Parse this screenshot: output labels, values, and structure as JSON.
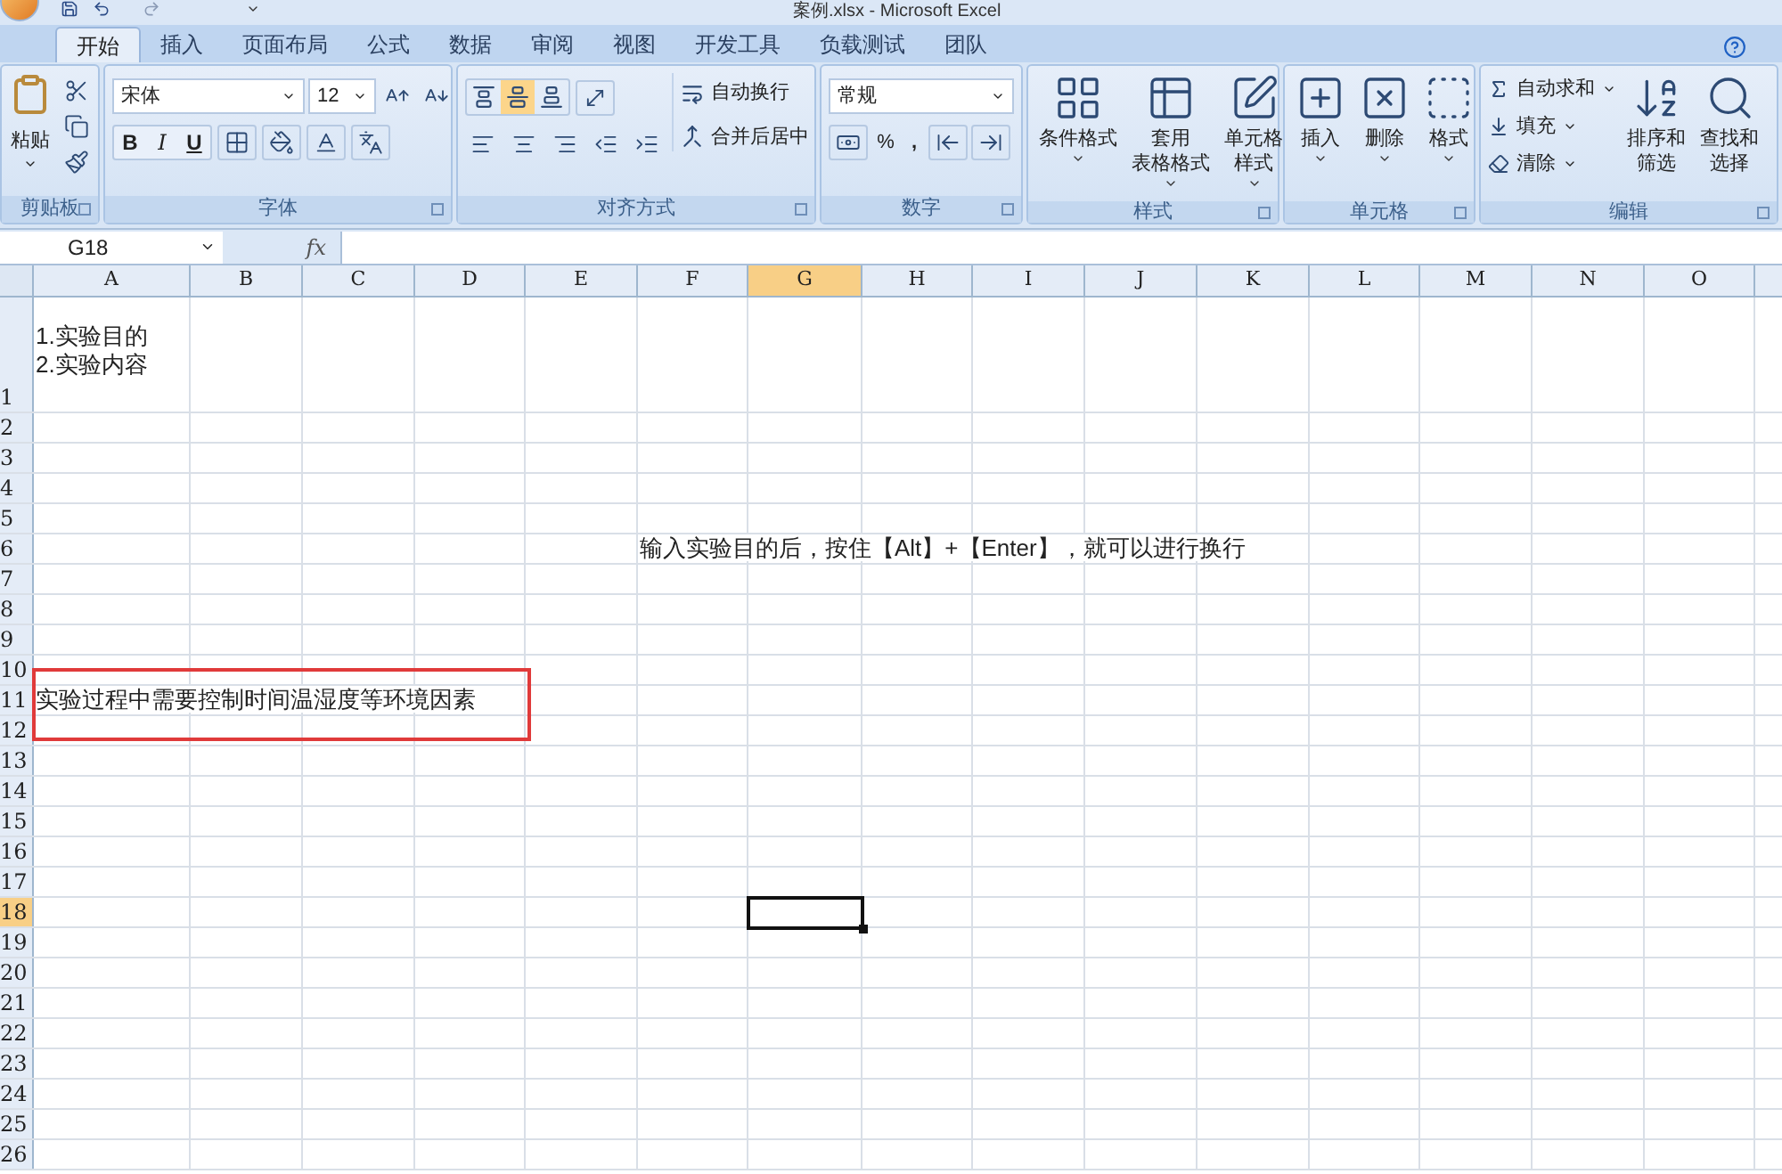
{
  "window": {
    "title": "案例.xlsx - Microsoft Excel"
  },
  "tabs": [
    {
      "label": "开始",
      "selected": true
    },
    {
      "label": "插入",
      "selected": false
    },
    {
      "label": "页面布局",
      "selected": false
    },
    {
      "label": "公式",
      "selected": false
    },
    {
      "label": "数据",
      "selected": false
    },
    {
      "label": "审阅",
      "selected": false
    },
    {
      "label": "视图",
      "selected": false
    },
    {
      "label": "开发工具",
      "selected": false
    },
    {
      "label": "负载测试",
      "selected": false
    },
    {
      "label": "团队",
      "selected": false
    }
  ],
  "ribbon": {
    "clipboard": {
      "label": "剪贴板",
      "paste": "粘贴"
    },
    "font": {
      "label": "字体",
      "font_name": "宋体",
      "font_size": "12",
      "bold": "B",
      "italic": "I",
      "underline": "U"
    },
    "alignment": {
      "label": "对齐方式",
      "vertical": [
        {
          "selected": false
        },
        {
          "selected": true
        },
        {
          "selected": false
        }
      ],
      "wrap_text": "自动换行",
      "merge_center": "合并后居中"
    },
    "number": {
      "label": "数字",
      "format": "常规",
      "percent": "%",
      "comma": ","
    },
    "styles": {
      "label": "样式",
      "buttons": [
        [
          "条件格式"
        ],
        [
          "套用",
          "表格格式"
        ],
        [
          "单元格",
          "样式"
        ]
      ]
    },
    "cells": {
      "label": "单元格",
      "buttons": [
        "插入",
        "删除",
        "格式"
      ]
    },
    "editing": {
      "label": "编辑",
      "small": [
        "自动求和",
        "填充",
        "清除"
      ],
      "large": [
        [
          "排序和",
          "筛选"
        ],
        [
          "查找和",
          "选择"
        ]
      ]
    }
  },
  "name_box": "G18",
  "formula_label": "fx",
  "columns": [
    {
      "label": "A",
      "selected": false
    },
    {
      "label": "B",
      "selected": false
    },
    {
      "label": "C",
      "selected": false
    },
    {
      "label": "D",
      "selected": false
    },
    {
      "label": "E",
      "selected": false
    },
    {
      "label": "F",
      "selected": false
    },
    {
      "label": "G",
      "selected": true
    },
    {
      "label": "H",
      "selected": false
    },
    {
      "label": "I",
      "selected": false
    },
    {
      "label": "J",
      "selected": false
    },
    {
      "label": "K",
      "selected": false
    },
    {
      "label": "L",
      "selected": false
    },
    {
      "label": "M",
      "selected": false
    },
    {
      "label": "N",
      "selected": false
    },
    {
      "label": "O",
      "selected": false
    }
  ],
  "rows": [
    {
      "label": "1",
      "selected": false,
      "cells": [
        [
          "1.实验目的",
          "2.实验内容"
        ]
      ]
    },
    {
      "label": "2",
      "selected": false
    },
    {
      "label": "3",
      "selected": false
    },
    {
      "label": "4",
      "selected": false
    },
    {
      "label": "5",
      "selected": false
    },
    {
      "label": "6",
      "selected": false,
      "cells": [
        null,
        null,
        null,
        null,
        null,
        [
          "输入实验目的后，按住【Alt】+【Enter】，就可以进行换行"
        ]
      ]
    },
    {
      "label": "7",
      "selected": false
    },
    {
      "label": "8",
      "selected": false
    },
    {
      "label": "9",
      "selected": false
    },
    {
      "label": "10",
      "selected": false
    },
    {
      "label": "11",
      "selected": false,
      "cells": [
        [
          "实验过程中需要控制时间温湿度等环境因素"
        ]
      ]
    },
    {
      "label": "12",
      "selected": false
    },
    {
      "label": "13",
      "selected": false
    },
    {
      "label": "14",
      "selected": false
    },
    {
      "label": "15",
      "selected": false
    },
    {
      "label": "16",
      "selected": false
    },
    {
      "label": "17",
      "selected": false
    },
    {
      "label": "18",
      "selected": true
    },
    {
      "label": "19",
      "selected": false
    },
    {
      "label": "20",
      "selected": false
    },
    {
      "label": "21",
      "selected": false
    },
    {
      "label": "22",
      "selected": false
    },
    {
      "label": "23",
      "selected": false
    },
    {
      "label": "24",
      "selected": false
    },
    {
      "label": "25",
      "selected": false
    },
    {
      "label": "26",
      "selected": false
    }
  ]
}
